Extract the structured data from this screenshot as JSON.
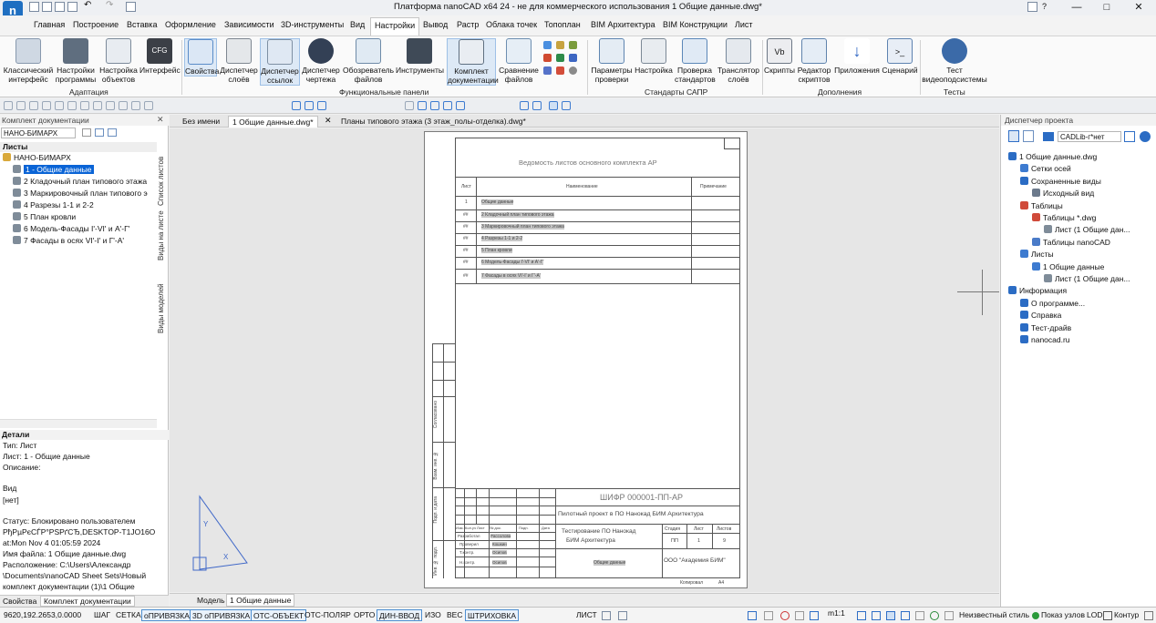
{
  "app": {
    "title": "Платформа nanoCAD x64 24 - не для коммерческого использования 1 Общие данные.dwg*",
    "logo_letter": "n",
    "help_label": "?",
    "window_buttons": [
      "—",
      "□",
      "✕"
    ]
  },
  "ribbon_tabs": [
    "Главная",
    "Построение",
    "Вставка",
    "Оформление",
    "Зависимости",
    "3D-инструменты",
    "Вид",
    "Настройки",
    "Вывод",
    "Растр",
    "Облака точек",
    "Топоплан",
    "BIM Архитектура",
    "BIM Конструкции",
    "Лист"
  ],
  "ribbon": {
    "buttons": [
      {
        "l1": "Классический",
        "l2": "интерфейс"
      },
      {
        "l1": "Настройки",
        "l2": "программы"
      },
      {
        "l1": "Настройка",
        "l2": "объектов"
      },
      {
        "l1": "Интерфейс",
        "l2": ""
      },
      {
        "l1": "Свойства",
        "l2": ""
      },
      {
        "l1": "Диспетчер",
        "l2": "слоёв"
      },
      {
        "l1": "Диспетчер",
        "l2": "ссылок"
      },
      {
        "l1": "Диспетчер",
        "l2": "чертежа"
      },
      {
        "l1": "Обозреватель",
        "l2": "файлов"
      },
      {
        "l1": "Инструменты",
        "l2": ""
      },
      {
        "l1": "Комплект",
        "l2": "документации"
      },
      {
        "l1": "Сравнение",
        "l2": "файлов"
      },
      {
        "l1": "Параметры",
        "l2": "проверки"
      },
      {
        "l1": "Настройка",
        "l2": ""
      },
      {
        "l1": "Проверка",
        "l2": "стандартов"
      },
      {
        "l1": "Транслятор",
        "l2": "слоёв"
      },
      {
        "l1": "Скрипты",
        "l2": ""
      },
      {
        "l1": "Редактор",
        "l2": "скриптов"
      },
      {
        "l1": "Приложения",
        "l2": ""
      },
      {
        "l1": "Сценарий",
        "l2": ""
      },
      {
        "l1": "Тест",
        "l2": "видеоподсистемы"
      }
    ],
    "cfg_label": "CFG",
    "groups": [
      "Адаптация",
      "Функциональные панели",
      "Стандарты САПР",
      "Дополнения",
      "Тесты"
    ]
  },
  "left_panel": {
    "title": "Комплект документации",
    "combo": "НАНО-БИМАРХ",
    "section": "Листы",
    "root": "НАНО-БИМАРХ",
    "sheets": [
      "1 - Общие данные",
      "2 Кладочный план типового этажа",
      "3 Маркировочный план типового э",
      "4 Разрезы 1-1 и 2-2",
      "5 План кровли",
      "6 Модель-Фасады I'-VI' и А'-Г'",
      "7 Фасады в осях VI'-I' и Г'-А'"
    ],
    "vertical_tabs": [
      "Список листов",
      "Виды на листе",
      "Виды моделей"
    ],
    "details_title": "Детали",
    "details": [
      "Тип: Лист",
      "Лист: 1 - Общие данные",
      "Описание:",
      "",
      "Вид",
      "[нет]",
      "",
      "Статус: Блокировано пользователем",
      "РђРµРєСЃР°РЅРґСЂ,DESKTOP-T1JO16O",
      "at:Mon Nov  4 01:05:59 2024",
      "Имя файла: 1 Общие данные.dwg",
      "Расположение: C:\\Users\\Александр",
      "\\Documents\\nanoCAD Sheet Sets\\Новый",
      "комплект документации (1)\\1 Общие"
    ],
    "bottom_tabs": [
      "Свойства",
      "Комплект документации"
    ]
  },
  "doc_tabs": [
    "Без имени",
    "1 Общие данные.dwg*",
    "Планы типового этажа (3 этаж_полы-отделка).dwg*"
  ],
  "drawing": {
    "title": "Ведомость листов основного комплекта АР",
    "col_sheet": "Лист",
    "col_name": "Наименование",
    "col_note": "Примечание",
    "rows": [
      {
        "num": "1",
        "name": "Общие данные"
      },
      {
        "num": "##",
        "name": "2 Кладочный план типового этажа"
      },
      {
        "num": "##",
        "name": "3 Маркировочный план типового этажа"
      },
      {
        "num": "##",
        "name": "4 Разрезы 1-1 и 2-2"
      },
      {
        "num": "##",
        "name": "5 План кровли"
      },
      {
        "num": "##",
        "name": "6 Модель-Фасады I'-VI' и А'-Г'"
      },
      {
        "num": "##",
        "name": "7 Фасады в осях VI'-I' и Г'-А'"
      }
    ],
    "code": "ШИФР 000001-ПП-АР",
    "project": "Пилотный проект в ПО Нанокад БИМ Архитектура",
    "obj_line1": "Тестирование ПО Нанокад",
    "obj_line2": "БИМ Архитектура",
    "sheet_title": "Общие данные",
    "stage_h": "Стадия",
    "sheet_h": "Лист",
    "sheets_h": "Листов",
    "stage": "ПП",
    "sheet": "1",
    "sheets": "9",
    "org": "ООО \"Академия БИМ\"",
    "copied": "Копировал",
    "format": "А4",
    "header_cols": [
      "Изм.",
      "Кол.уч",
      "Лист",
      "№ док.",
      "Подп.",
      "Дата"
    ],
    "roles": [
      "Разработал",
      "Проверил",
      "Т.контр.",
      "Н.контр."
    ],
    "names": [
      "Рассолова",
      "Кошкин",
      "Осипов",
      "Осипов"
    ],
    "side_labels": [
      "Согласовано",
      "Взам. инв. №",
      "Подп. и дата",
      "Инв. № подл."
    ]
  },
  "model_tabs": [
    "Модель",
    "1 Общие данные"
  ],
  "right_panel": {
    "title": "Диспетчер проекта",
    "combo": "CADLib-г*нет под",
    "tree": [
      {
        "text": "1 Общие данные.dwg",
        "lvl": 0
      },
      {
        "text": "Сетки осей",
        "lvl": 1
      },
      {
        "text": "Сохраненные виды",
        "lvl": 1
      },
      {
        "text": "Исходный вид",
        "lvl": 2
      },
      {
        "text": "Таблицы",
        "lvl": 1
      },
      {
        "text": "Таблицы *.dwg",
        "lvl": 2
      },
      {
        "text": "Лист (1 Общие дан...",
        "lvl": 3
      },
      {
        "text": "Таблицы nanoCAD",
        "lvl": 2
      },
      {
        "text": "Листы",
        "lvl": 1
      },
      {
        "text": "1 Общие данные",
        "lvl": 2
      },
      {
        "text": "Лист (1 Общие дан...",
        "lvl": 3
      },
      {
        "text": "Информация",
        "lvl": 0
      },
      {
        "text": "О программе...",
        "lvl": 1
      },
      {
        "text": "Справка",
        "lvl": 1
      },
      {
        "text": "Тест-драйв",
        "lvl": 1
      },
      {
        "text": "nanocad.ru",
        "lvl": 1
      }
    ]
  },
  "status": {
    "coords": "9620,192.2653,0.0000",
    "toggles": [
      "ШАГ",
      "СЕТКА",
      "оПРИВЯЗКА",
      "3D оПРИВЯЗКА",
      "ОТС-ОБЪЕКТ",
      "ОТС-ПОЛЯР",
      "ОРТО",
      "ДИН-ВВОД",
      "ИЗО",
      "ВЕС",
      "ШТРИХОВКА"
    ],
    "active": [
      false,
      false,
      true,
      true,
      true,
      false,
      false,
      true,
      false,
      false,
      true
    ],
    "sheet_label": "ЛИСТ",
    "scale": "m1:1",
    "style": "Неизвестный стиль",
    "nodes": "Показ узлов",
    "lod": "LOD",
    "contour": "Контур"
  },
  "colors": {
    "accent": "#2f7bd6",
    "selection": "#0a64d6",
    "sheet_border": "#7b7b7b"
  }
}
